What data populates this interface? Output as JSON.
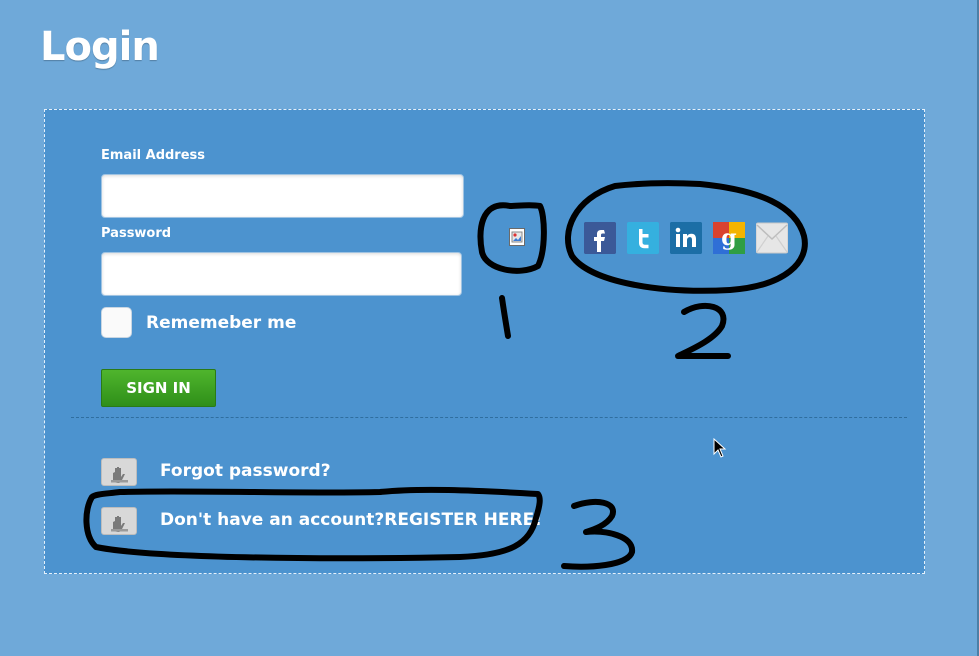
{
  "page": {
    "title": "Login"
  },
  "form": {
    "email_label": "Email Address",
    "email_value": "",
    "password_label": "Password",
    "password_value": "",
    "remember_label": "Rememeber me",
    "signin_label": "SIGN IN"
  },
  "social": {
    "items": [
      {
        "name": "facebook",
        "glyph": "f",
        "color": "#3b5998"
      },
      {
        "name": "twitter",
        "glyph": "t",
        "color": "#2fa8d8"
      },
      {
        "name": "linkedin",
        "glyph": "in",
        "color": "#1c6ea6"
      },
      {
        "name": "google",
        "glyph": "g",
        "color": "#d9422f"
      },
      {
        "name": "email",
        "glyph": "envelope",
        "color": "#dddddd"
      }
    ]
  },
  "links": {
    "forgot": "Forgot password?",
    "register": "Don't have an account?REGISTER HERE!"
  },
  "annotations": {
    "mark1": "1",
    "mark2": "2",
    "mark3": "3"
  },
  "colors": {
    "background": "#6fa9d9",
    "panel": "#4c93cf",
    "signin": "#3aa222"
  }
}
